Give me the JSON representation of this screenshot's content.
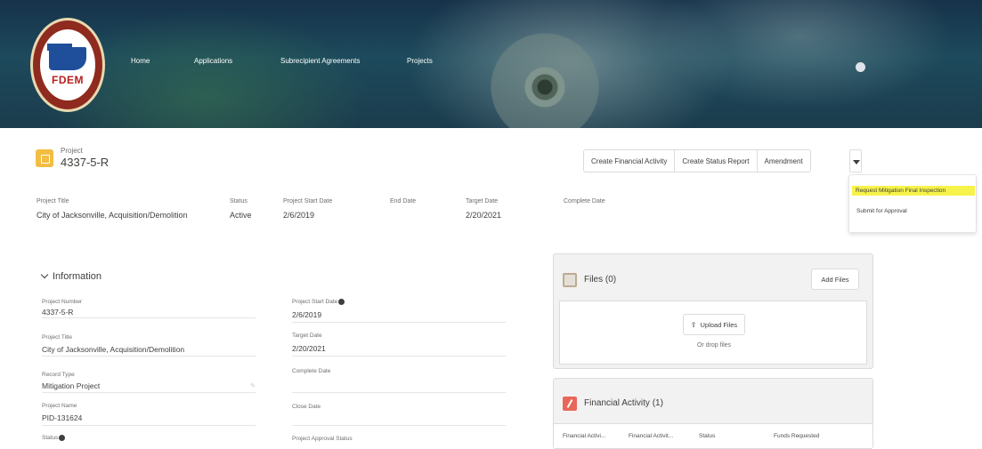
{
  "header": {
    "logo_text": "FDEM",
    "nav": [
      "Home",
      "Applications",
      "Subrecipient Agreements",
      "Projects"
    ]
  },
  "record": {
    "type_label": "Project",
    "number": "4337-5-R"
  },
  "actions": {
    "buttons": [
      "Create Financial Activity",
      "Create Status Report",
      "Amendment"
    ],
    "menu": [
      "Request Mitigation Final Inspection",
      "Submit for Approval"
    ]
  },
  "highlights": [
    {
      "label": "Project Title",
      "value": "City of Jacksonville, Acquisition/Demolition"
    },
    {
      "label": "Status",
      "value": "Active"
    },
    {
      "label": "Project Start Date",
      "value": "2/6/2019"
    },
    {
      "label": "End Date",
      "value": ""
    },
    {
      "label": "Target Date",
      "value": "2/20/2021"
    },
    {
      "label": "Complete Date",
      "value": ""
    }
  ],
  "info": {
    "heading": "Information",
    "left": [
      {
        "label": "Project Number",
        "value": "4337-5-R"
      },
      {
        "label": "Project Title",
        "value": "City of Jacksonville, Acquisition/Demolition"
      },
      {
        "label": "Record Type",
        "value": "Mitigation Project"
      },
      {
        "label": "Project Name",
        "value": "PID-131624"
      },
      {
        "label": "Status",
        "value": ""
      }
    ],
    "right": [
      {
        "label": "Project Start Date",
        "value": "2/6/2019"
      },
      {
        "label": "Target Date",
        "value": "2/20/2021"
      },
      {
        "label": "Complete Date",
        "value": ""
      },
      {
        "label": "Close Date",
        "value": ""
      },
      {
        "label": "Project Approval Status",
        "value": ""
      }
    ]
  },
  "files": {
    "title": "Files (0)",
    "add_label": "Add Files",
    "upload_label": "Upload Files",
    "drop_label": "Or drop files"
  },
  "financial": {
    "title": "Financial Activity (1)",
    "columns": [
      "Financial Activi...",
      "Financial Activit...",
      "Status",
      "Funds Requested"
    ]
  },
  "colors": {
    "highlight": "#f7f34a",
    "project_icon": "#f2bd42",
    "financial_icon": "#e9675a"
  }
}
